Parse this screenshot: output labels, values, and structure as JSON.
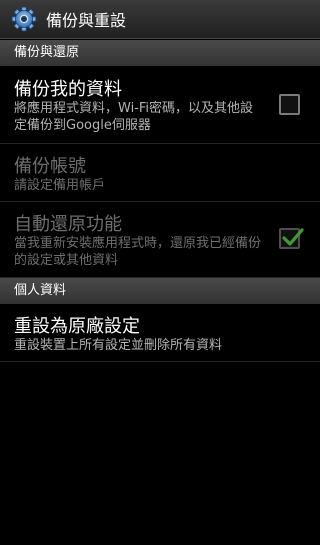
{
  "header": {
    "title": "備份與重設",
    "icon": "gear-icon"
  },
  "sections": [
    {
      "title": "備份與還原",
      "items": [
        {
          "title": "備份我的資料",
          "summary": "將應用程式資料，Wi-Fi密碼，以及其他設定備份到Google伺服器",
          "checked": false,
          "enabled": true
        },
        {
          "title": "備份帳號",
          "summary": "請設定備用帳戶",
          "enabled": false
        },
        {
          "title": "自動還原功能",
          "summary": "當我重新安裝應用程式時，還原我已經備份的設定或其他資料",
          "checked": true,
          "enabled": false
        }
      ]
    },
    {
      "title": "個人資料",
      "items": [
        {
          "title": "重設為原廠設定",
          "summary": "重設裝置上所有設定並刪除所有資料",
          "enabled": true
        }
      ]
    }
  ],
  "colors": {
    "background": "#000000",
    "checkmark": "#3f9c35",
    "disabled_text": "#6e6e6e"
  }
}
